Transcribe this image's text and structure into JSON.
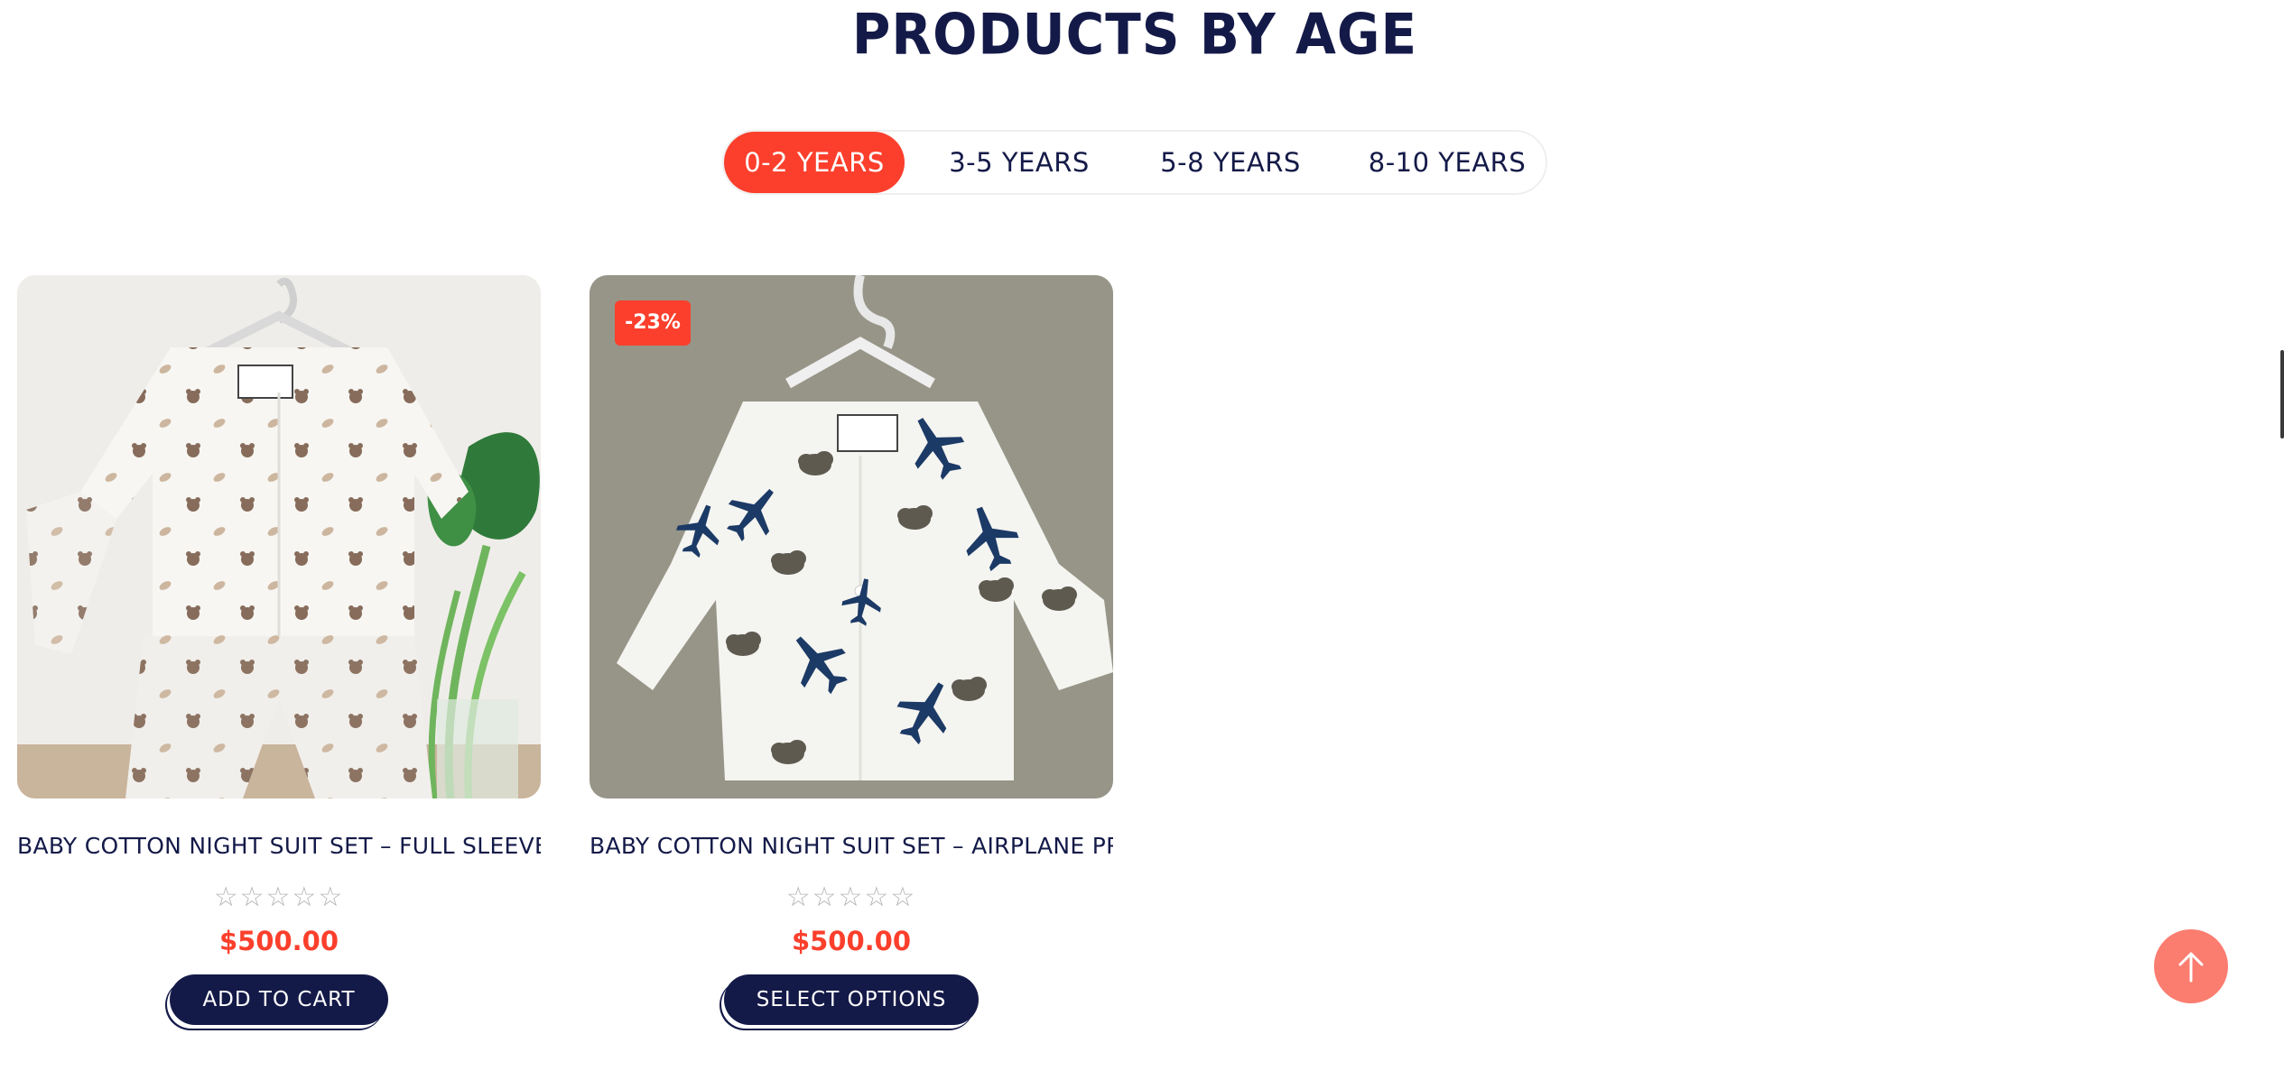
{
  "section": {
    "title": "PRODUCTS BY AGE"
  },
  "tabs": [
    {
      "label": "0-2 YEARS",
      "active": true
    },
    {
      "label": "3-5 YEARS",
      "active": false
    },
    {
      "label": "5-8 YEARS",
      "active": false
    },
    {
      "label": "8-10 YEARS",
      "active": false
    }
  ],
  "products": [
    {
      "title": "BABY COTTON NIGHT SUIT SET – FULL SLEEVE SHIRT ...",
      "rating": 0,
      "rating_max": 5,
      "stars": "☆☆☆☆☆",
      "price": "$500.00",
      "button_label": "ADD TO CART",
      "badge": null,
      "image_icon": "teddy-bear-print-suit-image"
    },
    {
      "title": "BABY COTTON NIGHT SUIT SET – AIRPLANE PRINT...",
      "rating": 0,
      "rating_max": 5,
      "stars": "☆☆☆☆☆",
      "price": "$500.00",
      "button_label": "SELECT OPTIONS",
      "badge": "-23%",
      "image_icon": "airplane-print-shirt-image"
    }
  ],
  "scroll_top": {
    "icon": "arrow-up-icon"
  },
  "colors": {
    "accent": "#fb3f2c",
    "navy": "#141a48",
    "scroll_button": "#fb7d70",
    "star": "#b4b4b4"
  }
}
